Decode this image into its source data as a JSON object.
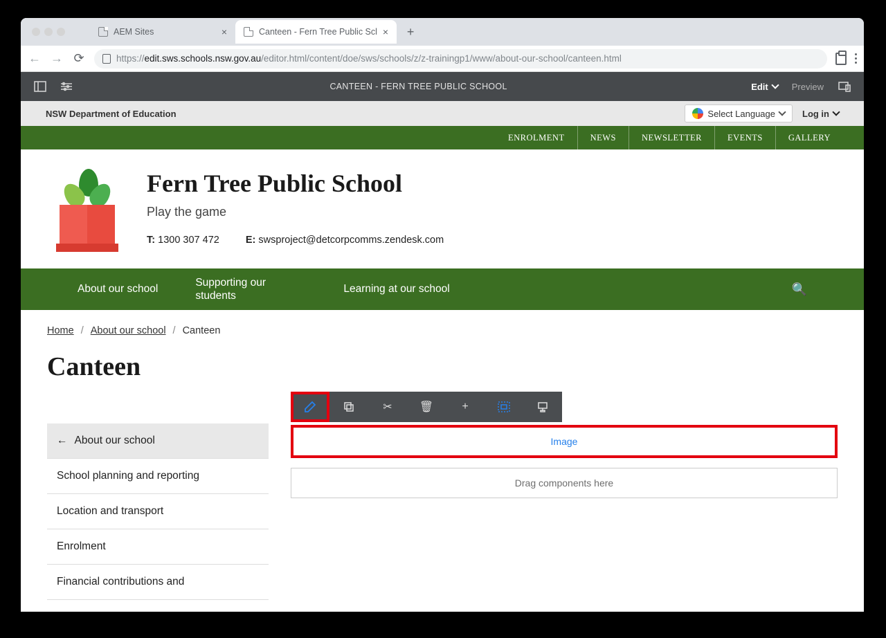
{
  "browser": {
    "tabs": [
      {
        "title": "AEM Sites"
      },
      {
        "title": "Canteen - Fern Tree Public Scl"
      }
    ],
    "url_host": "edit.sws.schools.nsw.gov.au",
    "url_path": "/editor.html/content/doe/sws/schools/z/z-trainingp1/www/about-our-school/canteen.html"
  },
  "aem": {
    "title": "CANTEEN - FERN TREE PUBLIC SCHOOL",
    "edit": "Edit",
    "preview": "Preview"
  },
  "dept": {
    "label": "NSW Department of Education",
    "lang": "Select Language",
    "login": "Log in"
  },
  "topnav": [
    "ENROLMENT",
    "NEWS",
    "NEWSLETTER",
    "EVENTS",
    "GALLERY"
  ],
  "school": {
    "name": "Fern Tree Public School",
    "tagline": "Play the game",
    "phone_label": "T:",
    "phone": "1300 307 472",
    "email_label": "E:",
    "email": "swsproject@detcorpcomms.zendesk.com"
  },
  "mainnav": [
    "About our school",
    "Supporting our students",
    "Learning at our school"
  ],
  "breadcrumbs": {
    "home": "Home",
    "parent": "About our school",
    "current": "Canteen"
  },
  "page_title": "Canteen",
  "sidenav": [
    "About our school",
    "School planning and reporting",
    "Location and transport",
    "Enrolment",
    "Financial contributions and"
  ],
  "editor": {
    "image_label": "Image",
    "drag_label": "Drag components here"
  }
}
